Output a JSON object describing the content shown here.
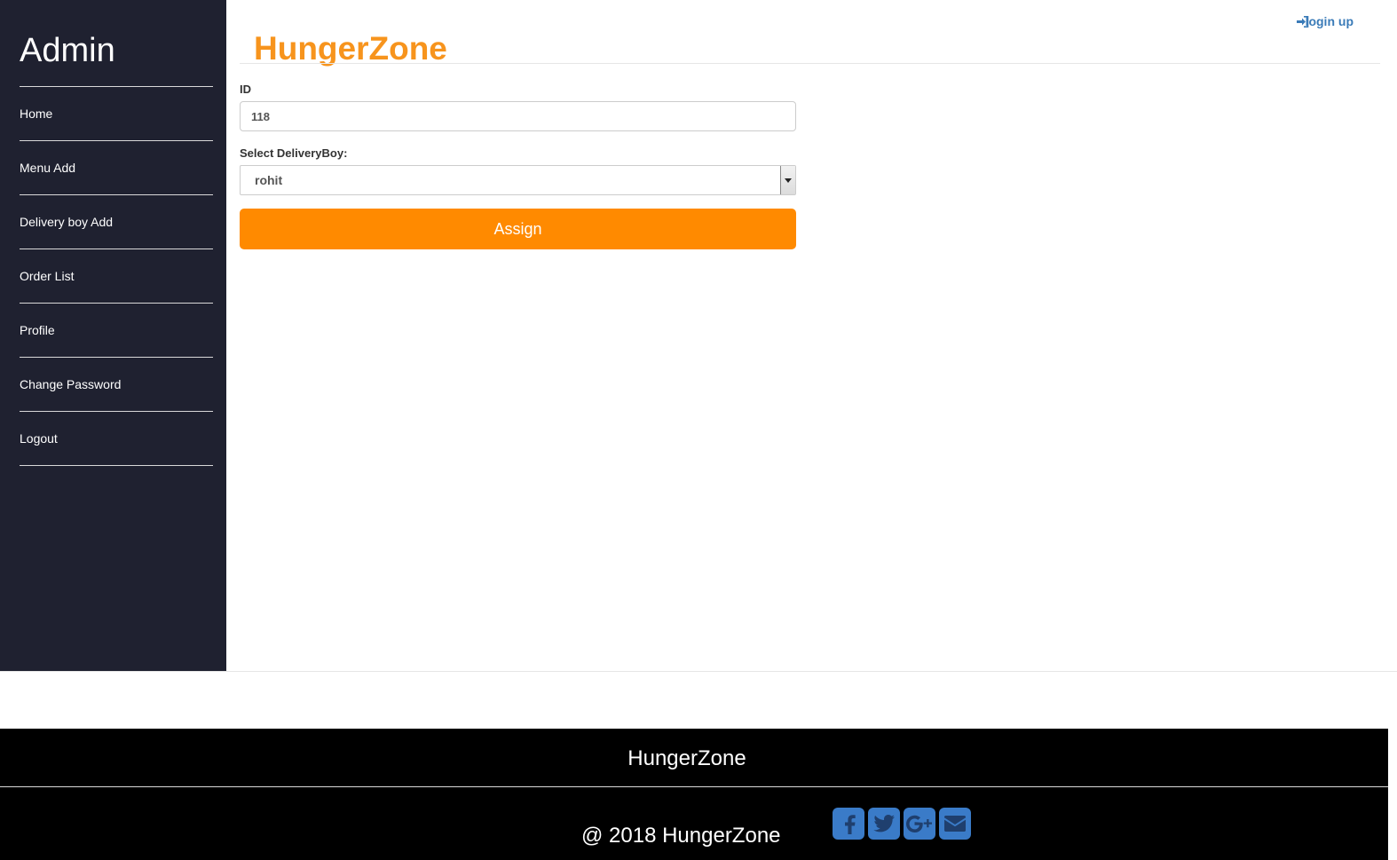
{
  "sidebar": {
    "title": "Admin",
    "items": [
      {
        "label": "Home"
      },
      {
        "label": "Menu Add"
      },
      {
        "label": "Delivery boy Add"
      },
      {
        "label": "Order List"
      },
      {
        "label": "Profile"
      },
      {
        "label": "Change Password"
      },
      {
        "label": "Logout"
      }
    ]
  },
  "header": {
    "brand": "HungerZone",
    "login_label": "login up",
    "login_icon": "sign-in-icon"
  },
  "form": {
    "id_label": "ID",
    "id_value": "118",
    "select_label": "Select DeliveryBoy:",
    "select_value": "rohit",
    "assign_label": "Assign"
  },
  "footer": {
    "brand": "HungerZone",
    "copyright": "@ 2018 HungerZone",
    "social": [
      {
        "name": "facebook-icon"
      },
      {
        "name": "twitter-icon"
      },
      {
        "name": "google-plus-icon"
      },
      {
        "name": "email-icon"
      }
    ]
  },
  "colors": {
    "sidebar_bg": "#1f2130",
    "brand_orange": "#f7941d",
    "button_orange": "#ff8a00",
    "link_blue": "#3a7bb8",
    "social_blue": "#3a7bc8",
    "footer_bg": "#000000"
  }
}
